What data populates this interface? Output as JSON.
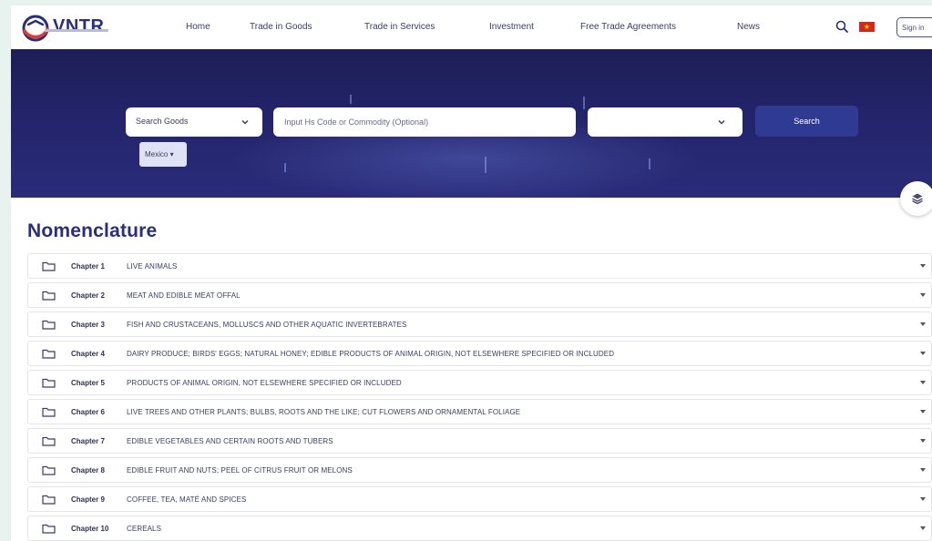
{
  "brand": {
    "name": "VNTR"
  },
  "nav": [
    {
      "label": "Home"
    },
    {
      "label": "Trade in Goods"
    },
    {
      "label": "Trade in Services"
    },
    {
      "label": "Investment"
    },
    {
      "label": "Free Trade Agreements"
    },
    {
      "label": "News"
    }
  ],
  "header": {
    "signin_label": "Sign in"
  },
  "search": {
    "type_select": "Search Goods",
    "code_placeholder": "Input Hs Code or Commodity (Optional)",
    "country_select": "",
    "button_label": "Search",
    "chip_label": "Mexico"
  },
  "section": {
    "title": "Nomenclature"
  },
  "chapters": [
    {
      "no": "Chapter 1",
      "name": "LIVE ANIMALS"
    },
    {
      "no": "Chapter 2",
      "name": "MEAT AND EDIBLE MEAT OFFAL"
    },
    {
      "no": "Chapter 3",
      "name": "FISH AND CRUSTACEANS, MOLLUSCS AND OTHER AQUATIC INVERTEBRATES"
    },
    {
      "no": "Chapter 4",
      "name": "DAIRY PRODUCE; BIRDS' EGGS; NATURAL HONEY; EDIBLE PRODUCTS OF ANIMAL ORIGIN, NOT ELSEWHERE SPECIFIED OR INCLUDED"
    },
    {
      "no": "Chapter 5",
      "name": "PRODUCTS OF ANIMAL ORIGIN, NOT ELSEWHERE SPECIFIED OR INCLUDED"
    },
    {
      "no": "Chapter 6",
      "name": "LIVE TREES AND OTHER PLANTS; BULBS, ROOTS AND THE LIKE; CUT FLOWERS AND ORNAMENTAL FOLIAGE"
    },
    {
      "no": "Chapter 7",
      "name": "EDIBLE VEGETABLES AND CERTAIN ROOTS AND TUBERS"
    },
    {
      "no": "Chapter 8",
      "name": "EDIBLE FRUIT AND NUTS; PEEL OF CITRUS FRUIT OR MELONS"
    },
    {
      "no": "Chapter 9",
      "name": "COFFEE, TEA, MATÉ AND SPICES"
    },
    {
      "no": "Chapter 10",
      "name": "CEREALS"
    }
  ],
  "colors": {
    "brand_navy": "#2b2f7a",
    "banner_bg": "#1d1e57",
    "search_button": "#2f3a93",
    "flag_red": "#d7261e",
    "flag_star": "#ffde00",
    "page_bg": "#e8f3f0"
  },
  "icons": {
    "search": "search-icon",
    "flag": "vietnam-flag-icon",
    "folder": "folder-icon",
    "caret": "caret-down-icon",
    "fab": "layers-icon"
  }
}
